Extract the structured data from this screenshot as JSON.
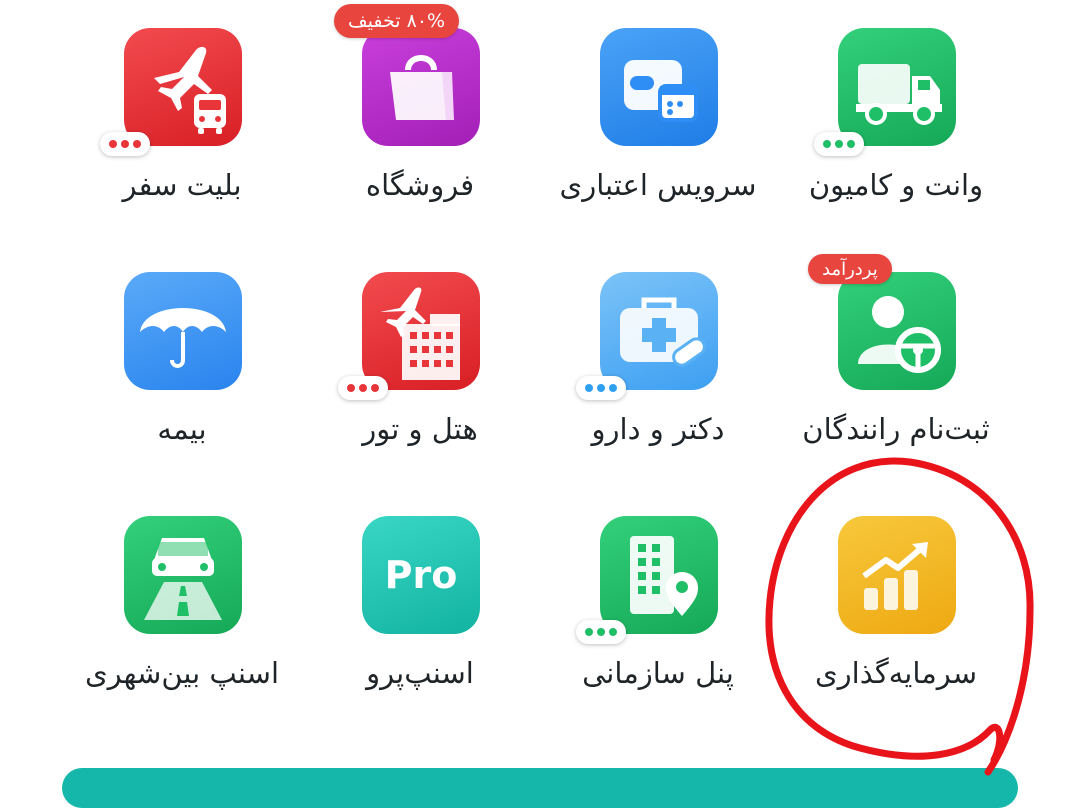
{
  "services": [
    {
      "key": "travel-tickets",
      "label": "بلیت سفر",
      "icon": "airplane-bus-icon",
      "color": "#e8353a",
      "has_more": true
    },
    {
      "key": "store",
      "label": "فروشگاه",
      "icon": "shopping-bag-icon",
      "color": "#b82ec9",
      "badge": "۸۰% تخفیف",
      "has_more": false
    },
    {
      "key": "credit-service",
      "label": "سرویس اعتباری",
      "icon": "wallet-calendar-icon",
      "color": "#2f8ef5",
      "has_more": false
    },
    {
      "key": "van-truck",
      "label": "وانت و کامیون",
      "icon": "truck-icon",
      "color": "#1fbf67",
      "has_more": true
    },
    {
      "key": "insurance",
      "label": "بیمه",
      "icon": "umbrella-icon",
      "color": "#3b97f6",
      "has_more": false
    },
    {
      "key": "hotel-tour",
      "label": "هتل و تور",
      "icon": "airplane-building-icon",
      "color": "#e8353a",
      "has_more": true
    },
    {
      "key": "doctor-medicine",
      "label": "دکتر و دارو",
      "icon": "medical-kit-icon",
      "color": "#5ab2f5",
      "has_more": true
    },
    {
      "key": "driver-signup",
      "label": "ثبت‌نام رانندگان",
      "icon": "driver-steering-icon",
      "color": "#1fbf67",
      "badge": "پردرآمد",
      "has_more": false
    },
    {
      "key": "intercity",
      "label": "اسنپ بین‌شهری",
      "icon": "car-road-icon",
      "color": "#1fbf67",
      "has_more": false
    },
    {
      "key": "snapp-pro",
      "label": "اسنپ‌پرو",
      "icon": "pro-icon",
      "color": "#1fc6b4",
      "icon_text": "Pro",
      "has_more": false
    },
    {
      "key": "org-panel",
      "label": "پنل سازمانی",
      "icon": "building-pin-icon",
      "color": "#1fbf67",
      "has_more": true
    },
    {
      "key": "investment",
      "label": "سرمایه‌گذاری",
      "icon": "chart-growth-icon",
      "color": "#f2b51f",
      "has_more": false
    }
  ],
  "colors": {
    "red_dots": "#e8353a",
    "green_dots": "#1fbf67",
    "blue_dots": "#2f9ff0",
    "badge_red": "#e8453f",
    "annotation": "#e8141a",
    "bottom_bar": "#16b7ab"
  }
}
